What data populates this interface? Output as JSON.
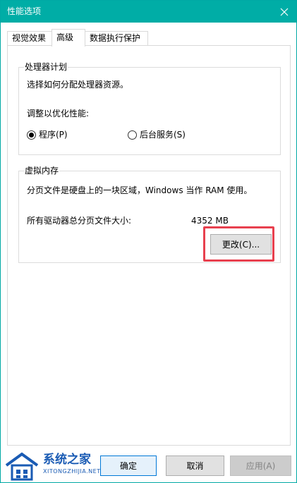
{
  "window": {
    "title": "性能选项"
  },
  "tabs": [
    {
      "label": "视觉效果"
    },
    {
      "label": "高级"
    },
    {
      "label": "数据执行保护"
    }
  ],
  "processor_group": {
    "title": "处理器计划",
    "description": "选择如何分配处理器资源。",
    "adjust_label": "调整以优化性能:",
    "option_programs": "程序(P)",
    "option_services": "后台服务(S)",
    "selected": "programs"
  },
  "virtual_memory_group": {
    "title": "虚拟内存",
    "description": "分页文件是硬盘上的一块区域，Windows 当作 RAM 使用。",
    "total_label": "所有驱动器总分页文件大小:",
    "total_value": "4352 MB",
    "change_button": "更改(C)..."
  },
  "footer": {
    "ok_button": "确定",
    "cancel_button": "取消",
    "apply_button": "应用(A)"
  },
  "watermark": {
    "name": "系统之家",
    "url": "XITONGZHIJIA.NET"
  },
  "colors": {
    "titlebar": "#00ada6",
    "highlight": "#e8404e",
    "watermark": "#1a5bb4"
  }
}
